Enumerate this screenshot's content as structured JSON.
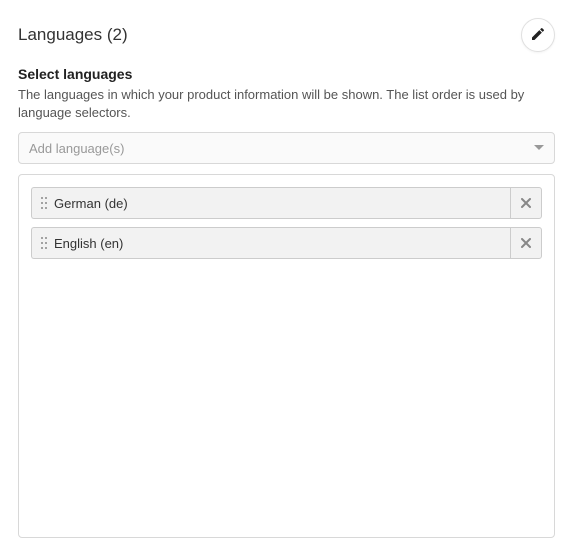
{
  "header": {
    "title": "Languages  (2)"
  },
  "section": {
    "heading": "Select languages",
    "description": "The languages in which your product information will be shown.  The list order is used by language selectors."
  },
  "dropdown": {
    "placeholder": "Add language(s)"
  },
  "languages": [
    {
      "label": "German (de)"
    },
    {
      "label": "English (en)"
    }
  ]
}
